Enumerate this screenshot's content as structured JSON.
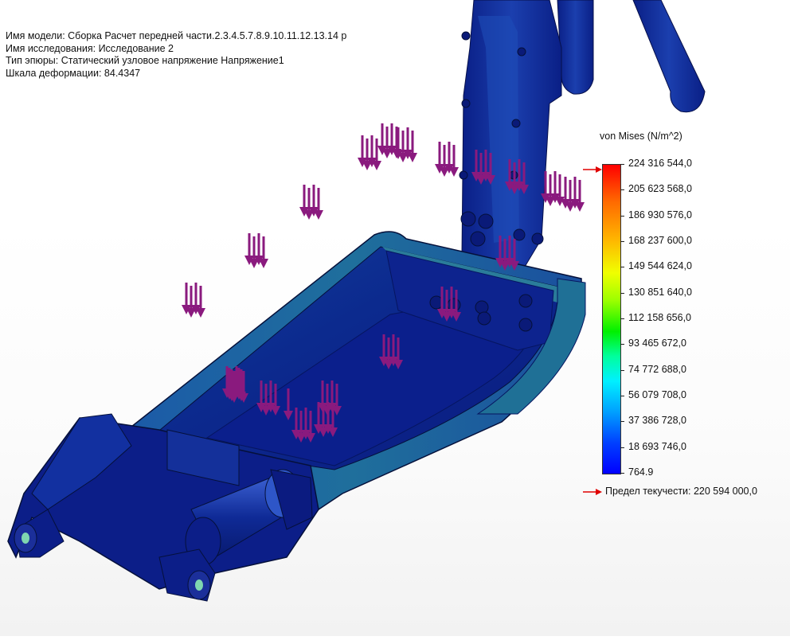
{
  "info": {
    "model_name": "Имя модели: Сборка Расчет передней части.2.3.4.5.7.8.9.10.11.12.13.14 р",
    "study_name": "Имя  исследования: Исследование 2",
    "plot_type": "Тип эпюры: Статический узловое напряжение Напряжение1",
    "deformation_scale": "Шкала деформации: 84.4347"
  },
  "legend": {
    "title": "von Mises (N/m^2)",
    "ticks": [
      "224 316 544,0",
      "205 623 568,0",
      "186 930 576,0",
      "168 237 600,0",
      "149 544 624,0",
      "130 851 640,0",
      "112 158 656,0",
      "93 465 672,0",
      "74 772 688,0",
      "56 079 708,0",
      "37 386 728,0",
      "18 693 746,0",
      "764.9"
    ],
    "yield_label": "Предел текучести: 220 594 000,0",
    "marker_color": "#e00000"
  },
  "colors": {
    "model_dark": "#0a1580",
    "model_mid": "#1c3aa8",
    "load_arrow": "#8a1a7e"
  },
  "load_arrow_groups": [
    {
      "count": 4
    },
    {
      "count": 4
    },
    {
      "count": 4
    },
    {
      "count": 4
    },
    {
      "count": 4
    },
    {
      "count": 4
    },
    {
      "count": 4
    },
    {
      "count": 4
    },
    {
      "count": 4
    },
    {
      "count": 4
    },
    {
      "count": 4
    },
    {
      "count": 4
    },
    {
      "count": 4
    },
    {
      "count": 4
    },
    {
      "count": 4
    },
    {
      "count": 4
    },
    {
      "count": 1
    },
    {
      "count": 4
    },
    {
      "count": 4
    },
    {
      "count": 4
    },
    {
      "count": 4
    }
  ]
}
